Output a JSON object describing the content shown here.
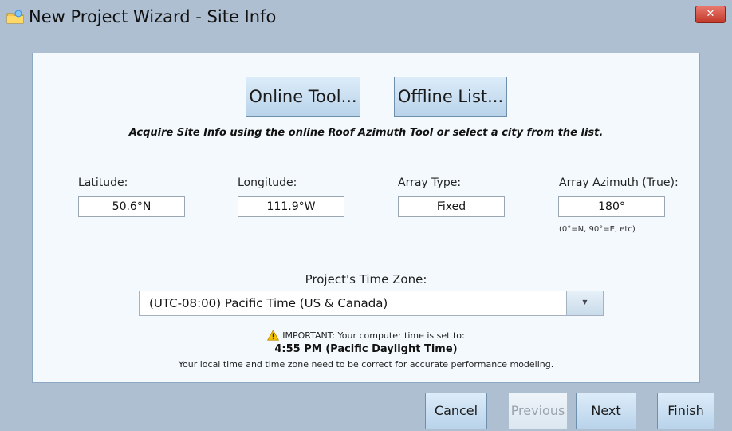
{
  "window": {
    "title": "New Project Wizard - Site Info",
    "close_glyph": "✕",
    "icon": "folder-sun-icon"
  },
  "tools": {
    "online_label": "Online Tool...",
    "offline_label": "Offline List...",
    "instructions": "Acquire Site Info using the online Roof Azimuth Tool or select a city from the list."
  },
  "fields": {
    "latitude": {
      "label": "Latitude:",
      "value": "50.6°N"
    },
    "longitude": {
      "label": "Longitude:",
      "value": "111.9°W"
    },
    "array_type": {
      "label": "Array Type:",
      "value": "Fixed"
    },
    "array_azimuth": {
      "label": "Array Azimuth (True):",
      "value": "180°",
      "hint": "(0°=N, 90°=E, etc)"
    }
  },
  "timezone": {
    "label": "Project's Time Zone:",
    "selected": "(UTC-08:00) Pacific Time (US & Canada)"
  },
  "notice": {
    "important": "IMPORTANT: Your computer time is set to:",
    "current_time": "4:55 PM (Pacific Daylight Time)",
    "note": "Your local time and time zone need to be correct for accurate performance modeling."
  },
  "footer": {
    "cancel": "Cancel",
    "previous": "Previous",
    "next": "Next",
    "finish": "Finish"
  },
  "colors": {
    "window_bg": "#aebfd1",
    "panel_bg": "#f3f9fc",
    "close_red": "#c2392b",
    "warning_yellow": "#f5c400"
  }
}
